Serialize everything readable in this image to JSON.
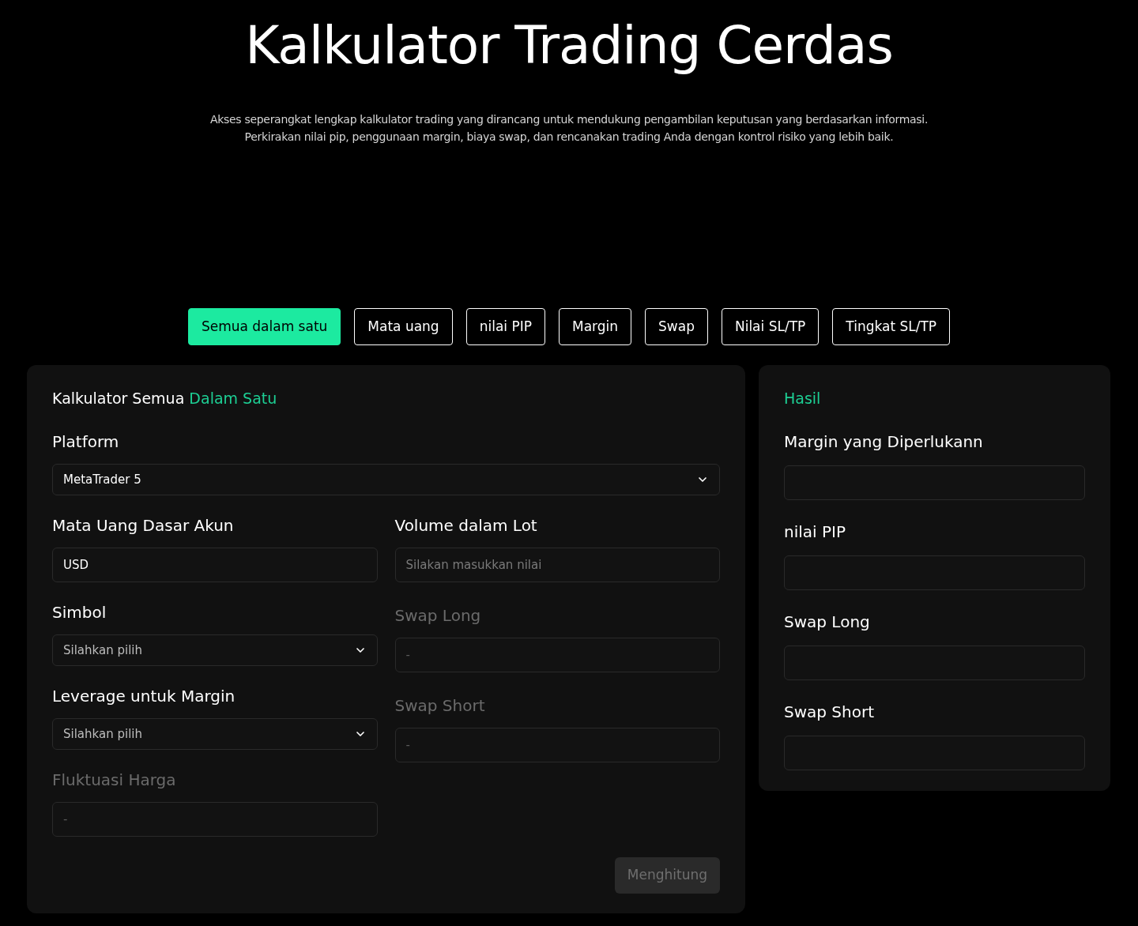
{
  "title": "Kalkulator Trading Cerdas",
  "subtitle": [
    "Akses seperangkat lengkap kalkulator trading yang dirancang untuk mendukung pengambilan keputusan yang berdasarkan informasi.",
    "Perkirakan nilai pip, penggunaan margin, biaya swap, dan rencanakan trading Anda dengan kontrol risiko yang lebih baik."
  ],
  "tabs": [
    {
      "label": "Semua dalam satu",
      "selected": true
    },
    {
      "label": "Mata uang",
      "selected": false
    },
    {
      "label": "nilai PIP",
      "selected": false
    },
    {
      "label": "Margin",
      "selected": false
    },
    {
      "label": "Swap",
      "selected": false
    },
    {
      "label": "Nilai SL/TP",
      "selected": false
    },
    {
      "label": "Tingkat SL/TP",
      "selected": false
    }
  ],
  "calculator": {
    "title": "Kalkulator Semua",
    "title_accent": "Dalam Satu",
    "platform": {
      "label": "Platform",
      "kind": "select",
      "value": "MetaTrader 5",
      "disabled": false
    },
    "left_fields": [
      {
        "label": "Mata Uang Dasar Akun",
        "kind": "input",
        "value": "USD",
        "disabled": false
      },
      {
        "label": "Simbol",
        "kind": "select",
        "placeholder": "Silahkan pilih",
        "disabled": false
      },
      {
        "label": "Leverage untuk Margin",
        "kind": "select",
        "placeholder": "Silahkan pilih",
        "disabled": false
      },
      {
        "label": "Fluktuasi Harga",
        "kind": "input",
        "placeholder": "-",
        "disabled": true
      }
    ],
    "right_fields": [
      {
        "label": "Volume dalam Lot",
        "kind": "input",
        "placeholder": "Silakan masukkan nilai",
        "disabled": false
      },
      {
        "label": "Swap Long",
        "kind": "input",
        "placeholder": "-",
        "disabled": true
      },
      {
        "label": "Swap Short",
        "kind": "input",
        "placeholder": "-",
        "disabled": true
      }
    ],
    "submit": {
      "label": "Menghitung",
      "disabled": true
    }
  },
  "results": {
    "title": "Hasil",
    "fields": [
      {
        "label": "Margin yang Diperlukann"
      },
      {
        "label": "nilai PIP"
      },
      {
        "label": "Swap Long"
      },
      {
        "label": "Swap Short"
      }
    ]
  }
}
